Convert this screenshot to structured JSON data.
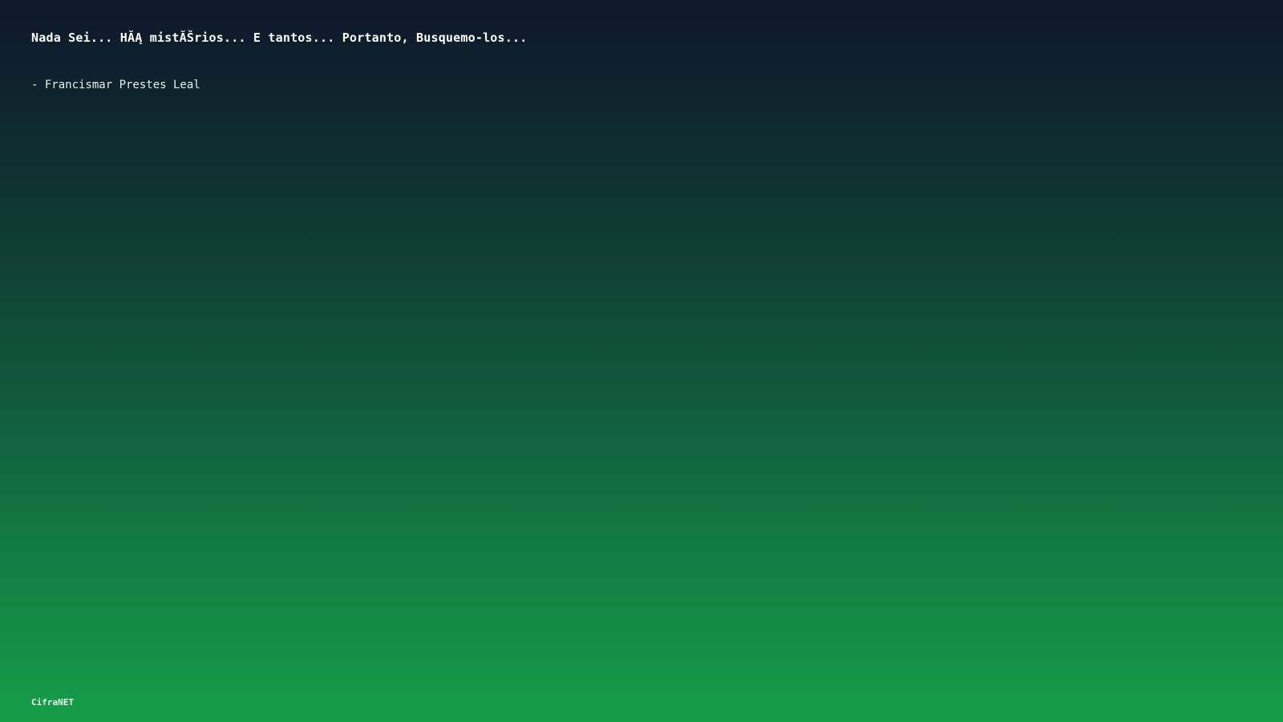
{
  "quote": {
    "text": "Nada Sei... HĂĄ mistĂŠrios... E tantos... Portanto, Busquemo-los...",
    "author": "- Francismar Prestes Leal"
  },
  "footer": {
    "brand": "CifraNET"
  },
  "colors": {
    "gradient_top": "#0e172c",
    "gradient_bottom": "#159e48",
    "text": "#ffffff"
  }
}
